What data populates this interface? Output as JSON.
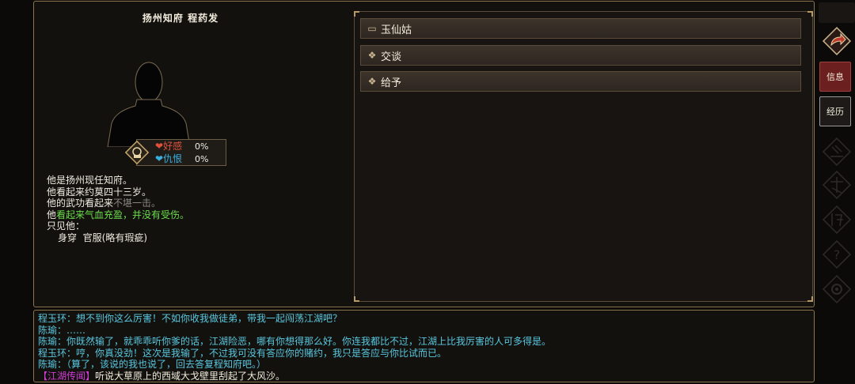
{
  "npc": {
    "title": "扬州知府  程药发",
    "favor_label": "好感",
    "favor_value": "0%",
    "hatred_label": "仇恨",
    "hatred_value": "0%",
    "description": {
      "line1": "他是扬州现任知府。",
      "line2": "他看起来约莫四十三岁。",
      "line3_prefix": "他的武功看起来",
      "line3_gray": "不堪一击。",
      "line4_prefix": "他",
      "line4_green": "看起来气血充盈，并没有受伤。",
      "line5": "只见他：",
      "line6_label": "身穿",
      "line6_item": "官服(略有瑕疵)"
    }
  },
  "actions": [
    {
      "label": "玉仙姑",
      "icon": "speech-scroll-icon"
    },
    {
      "label": "交谈",
      "icon": "diamond-icon"
    },
    {
      "label": "给予",
      "icon": "diamond-icon"
    }
  ],
  "sidebar": {
    "info_label": "信息",
    "experience_label": "经历"
  },
  "log": {
    "line1": "程玉环：想不到你这么厉害！不如你收我做徒弟，带我一起闯荡江湖吧？",
    "line2": "陈瑜：……",
    "line3": "陈瑜：你既然输了，就乖乖听你爹的话，江湖险恶，哪有你想得那么好。你连我都比不过，江湖上比我厉害的人可多得是。",
    "line4": "程玉环：哼，你真没劲！这次是我输了，不过我可没有答应你的赌约，我只是答应与你比试而已。",
    "line5": "陈瑜：（算了，该说的我也说了，回去答复程知府吧。）",
    "rumor_tag": "【江湖传闻】",
    "rumor_text": "听说大草原上的西域大戈壁里刮起了大风沙。"
  },
  "colors": {
    "accent_gold": "#8a7550",
    "dialog_cyan": "#58c8e0",
    "rumor_magenta": "#d23cd8",
    "healthy_green": "#6cde4c",
    "info_button_red": "#6b1f1f"
  }
}
